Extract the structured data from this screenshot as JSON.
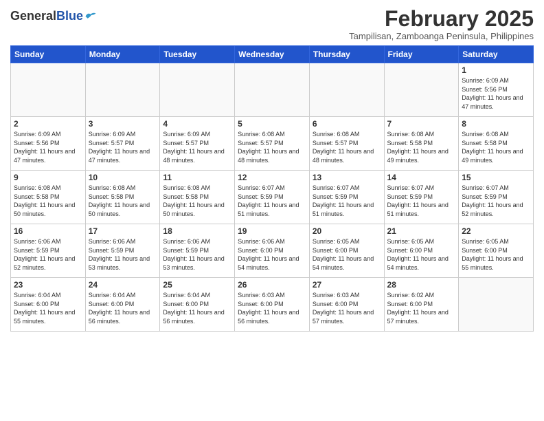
{
  "header": {
    "logo_line1": "General",
    "logo_line2": "Blue",
    "month_year": "February 2025",
    "location": "Tampilisan, Zamboanga Peninsula, Philippines"
  },
  "weekdays": [
    "Sunday",
    "Monday",
    "Tuesday",
    "Wednesday",
    "Thursday",
    "Friday",
    "Saturday"
  ],
  "weeks": [
    [
      {
        "day": "",
        "info": ""
      },
      {
        "day": "",
        "info": ""
      },
      {
        "day": "",
        "info": ""
      },
      {
        "day": "",
        "info": ""
      },
      {
        "day": "",
        "info": ""
      },
      {
        "day": "",
        "info": ""
      },
      {
        "day": "1",
        "info": "Sunrise: 6:09 AM\nSunset: 5:56 PM\nDaylight: 11 hours and 47 minutes."
      }
    ],
    [
      {
        "day": "2",
        "info": "Sunrise: 6:09 AM\nSunset: 5:56 PM\nDaylight: 11 hours and 47 minutes."
      },
      {
        "day": "3",
        "info": "Sunrise: 6:09 AM\nSunset: 5:57 PM\nDaylight: 11 hours and 47 minutes."
      },
      {
        "day": "4",
        "info": "Sunrise: 6:09 AM\nSunset: 5:57 PM\nDaylight: 11 hours and 48 minutes."
      },
      {
        "day": "5",
        "info": "Sunrise: 6:08 AM\nSunset: 5:57 PM\nDaylight: 11 hours and 48 minutes."
      },
      {
        "day": "6",
        "info": "Sunrise: 6:08 AM\nSunset: 5:57 PM\nDaylight: 11 hours and 48 minutes."
      },
      {
        "day": "7",
        "info": "Sunrise: 6:08 AM\nSunset: 5:58 PM\nDaylight: 11 hours and 49 minutes."
      },
      {
        "day": "8",
        "info": "Sunrise: 6:08 AM\nSunset: 5:58 PM\nDaylight: 11 hours and 49 minutes."
      }
    ],
    [
      {
        "day": "9",
        "info": "Sunrise: 6:08 AM\nSunset: 5:58 PM\nDaylight: 11 hours and 50 minutes."
      },
      {
        "day": "10",
        "info": "Sunrise: 6:08 AM\nSunset: 5:58 PM\nDaylight: 11 hours and 50 minutes."
      },
      {
        "day": "11",
        "info": "Sunrise: 6:08 AM\nSunset: 5:58 PM\nDaylight: 11 hours and 50 minutes."
      },
      {
        "day": "12",
        "info": "Sunrise: 6:07 AM\nSunset: 5:59 PM\nDaylight: 11 hours and 51 minutes."
      },
      {
        "day": "13",
        "info": "Sunrise: 6:07 AM\nSunset: 5:59 PM\nDaylight: 11 hours and 51 minutes."
      },
      {
        "day": "14",
        "info": "Sunrise: 6:07 AM\nSunset: 5:59 PM\nDaylight: 11 hours and 51 minutes."
      },
      {
        "day": "15",
        "info": "Sunrise: 6:07 AM\nSunset: 5:59 PM\nDaylight: 11 hours and 52 minutes."
      }
    ],
    [
      {
        "day": "16",
        "info": "Sunrise: 6:06 AM\nSunset: 5:59 PM\nDaylight: 11 hours and 52 minutes."
      },
      {
        "day": "17",
        "info": "Sunrise: 6:06 AM\nSunset: 5:59 PM\nDaylight: 11 hours and 53 minutes."
      },
      {
        "day": "18",
        "info": "Sunrise: 6:06 AM\nSunset: 5:59 PM\nDaylight: 11 hours and 53 minutes."
      },
      {
        "day": "19",
        "info": "Sunrise: 6:06 AM\nSunset: 6:00 PM\nDaylight: 11 hours and 54 minutes."
      },
      {
        "day": "20",
        "info": "Sunrise: 6:05 AM\nSunset: 6:00 PM\nDaylight: 11 hours and 54 minutes."
      },
      {
        "day": "21",
        "info": "Sunrise: 6:05 AM\nSunset: 6:00 PM\nDaylight: 11 hours and 54 minutes."
      },
      {
        "day": "22",
        "info": "Sunrise: 6:05 AM\nSunset: 6:00 PM\nDaylight: 11 hours and 55 minutes."
      }
    ],
    [
      {
        "day": "23",
        "info": "Sunrise: 6:04 AM\nSunset: 6:00 PM\nDaylight: 11 hours and 55 minutes."
      },
      {
        "day": "24",
        "info": "Sunrise: 6:04 AM\nSunset: 6:00 PM\nDaylight: 11 hours and 56 minutes."
      },
      {
        "day": "25",
        "info": "Sunrise: 6:04 AM\nSunset: 6:00 PM\nDaylight: 11 hours and 56 minutes."
      },
      {
        "day": "26",
        "info": "Sunrise: 6:03 AM\nSunset: 6:00 PM\nDaylight: 11 hours and 56 minutes."
      },
      {
        "day": "27",
        "info": "Sunrise: 6:03 AM\nSunset: 6:00 PM\nDaylight: 11 hours and 57 minutes."
      },
      {
        "day": "28",
        "info": "Sunrise: 6:02 AM\nSunset: 6:00 PM\nDaylight: 11 hours and 57 minutes."
      },
      {
        "day": "",
        "info": ""
      }
    ]
  ]
}
